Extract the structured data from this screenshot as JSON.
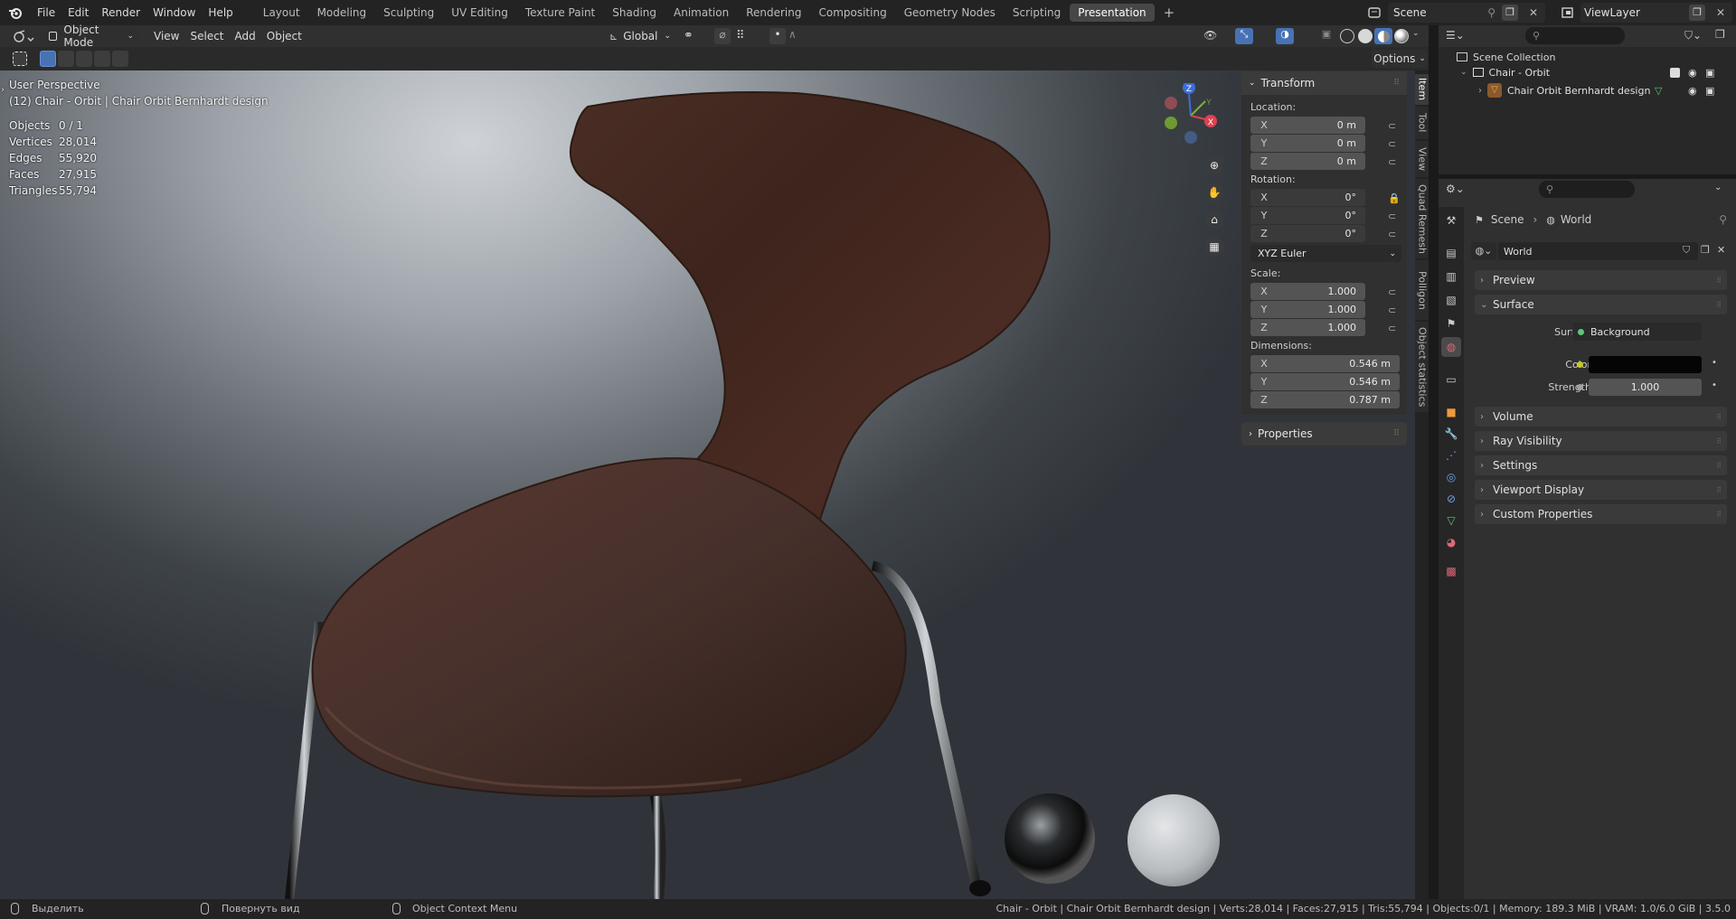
{
  "topbar": {
    "menus": [
      "File",
      "Edit",
      "Render",
      "Window",
      "Help"
    ],
    "workspaces": [
      "Layout",
      "Modeling",
      "Sculpting",
      "UV Editing",
      "Texture Paint",
      "Shading",
      "Animation",
      "Rendering",
      "Compositing",
      "Geometry Nodes",
      "Scripting",
      "Presentation"
    ],
    "active_workspace": "Presentation",
    "add_tab": "+",
    "scene_name": "Scene",
    "view_layer": "ViewLayer"
  },
  "viewport_header": {
    "mode": "Object Mode",
    "menus": [
      "View",
      "Select",
      "Add",
      "Object"
    ],
    "orientation": "Global",
    "options": "Options"
  },
  "overlay": {
    "view_name": "User Perspective",
    "object_path": "(12) Chair - Orbit | Chair Orbit Bernhardt design",
    "stats": [
      {
        "label": "Objects",
        "value": "0 / 1"
      },
      {
        "label": "Vertices",
        "value": "28,014"
      },
      {
        "label": "Edges",
        "value": "55,920"
      },
      {
        "label": "Faces",
        "value": "27,915"
      },
      {
        "label": "Triangles",
        "value": "55,794"
      }
    ]
  },
  "gizmo": {
    "x": "X",
    "y": "Y",
    "z": "Z"
  },
  "npanel": {
    "title": "Transform",
    "location_label": "Location:",
    "location": [
      {
        "axis": "X",
        "value": "0 m"
      },
      {
        "axis": "Y",
        "value": "0 m"
      },
      {
        "axis": "Z",
        "value": "0 m"
      }
    ],
    "rotation_label": "Rotation:",
    "rotation": [
      {
        "axis": "X",
        "value": "0°"
      },
      {
        "axis": "Y",
        "value": "0°"
      },
      {
        "axis": "Z",
        "value": "0°"
      }
    ],
    "rotation_mode": "XYZ Euler",
    "scale_label": "Scale:",
    "scale": [
      {
        "axis": "X",
        "value": "1.000"
      },
      {
        "axis": "Y",
        "value": "1.000"
      },
      {
        "axis": "Z",
        "value": "1.000"
      }
    ],
    "dimensions_label": "Dimensions:",
    "dimensions": [
      {
        "axis": "X",
        "value": "0.546 m"
      },
      {
        "axis": "Y",
        "value": "0.546 m"
      },
      {
        "axis": "Z",
        "value": "0.787 m"
      }
    ],
    "properties": "Properties",
    "tabs": [
      "Item",
      "Tool",
      "View",
      "Quad Remesh",
      "Polligon",
      "Object statistics"
    ]
  },
  "outliner": {
    "root": "Scene Collection",
    "collection": "Chair - Orbit",
    "object": "Chair Orbit Bernhardt design"
  },
  "properties": {
    "breadcrumb_scene": "Scene",
    "breadcrumb_world": "World",
    "world_name": "World",
    "sections": [
      "Preview",
      "Surface"
    ],
    "surface_label": "Surface",
    "surface_value": "Background",
    "color_label": "Color",
    "strength_label": "Strength",
    "strength_value": "1.000",
    "collapsed_sections": [
      "Volume",
      "Ray Visibility",
      "Settings",
      "Viewport Display",
      "Custom Properties"
    ],
    "color_swatch": "#050505"
  },
  "statusbar": {
    "select": "Выделить",
    "rotate": "Повернуть вид",
    "context": "Object Context Menu",
    "info": "Chair - Orbit | Chair Orbit Bernhardt design | Verts:28,014 | Faces:27,915 | Tris:55,794 | Objects:0/1 | Memory: 189.3 MiB | VRAM: 1.0/6.0 GiB | 3.5.0"
  }
}
